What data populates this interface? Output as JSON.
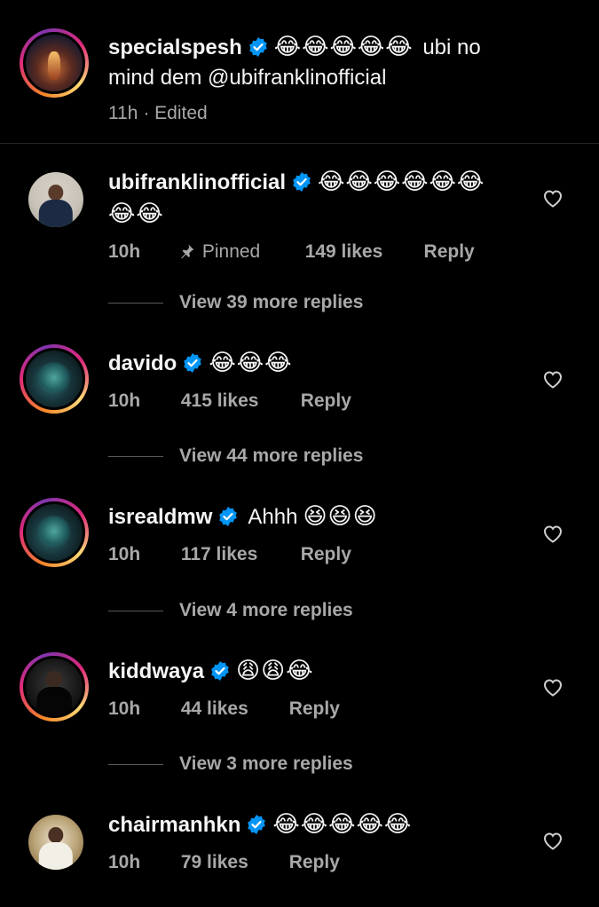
{
  "caption": {
    "username": "specialspesh",
    "emoji": "😂😂😂😂😂",
    "text_line1": "ubi no",
    "text_line2": "mind dem @ubifranklinofficial",
    "time": "11h",
    "separator": "·",
    "edited": "Edited",
    "avatar_icon": "avatar-image"
  },
  "comments": [
    {
      "username": "ubifranklinofficial",
      "emoji_line1": "😂😂😂😂😂😂",
      "emoji_line2": "😂😂",
      "time": "10h",
      "pinned": "Pinned",
      "likes": "149 likes",
      "reply": "Reply",
      "view_replies": "View 39 more replies"
    },
    {
      "username": "davido",
      "emoji_line1": "😂😂😂",
      "time": "10h",
      "likes": "415 likes",
      "reply": "Reply",
      "view_replies": "View 44 more replies"
    },
    {
      "username": "isrealdmw",
      "text": "Ahhh",
      "emoji_line1": "😆😆😆",
      "time": "10h",
      "likes": "117 likes",
      "reply": "Reply",
      "view_replies": "View 4 more replies"
    },
    {
      "username": "kiddwaya",
      "emoji_line1": "😩😩😂",
      "time": "10h",
      "likes": "44 likes",
      "reply": "Reply",
      "view_replies": "View 3 more replies"
    },
    {
      "username": "chairmanhkn",
      "emoji_line1": "😂😂😂😂😂",
      "time": "10h",
      "likes": "79 likes",
      "reply": "Reply"
    }
  ],
  "colors": {
    "background": "#000000",
    "text_primary": "#f5f5f5",
    "text_secondary": "#a8a8a8",
    "verified_blue": "#0095f6",
    "divider": "#262626"
  },
  "icons": {
    "verified": "verified-badge-icon",
    "heart": "heart-outline-icon",
    "pin": "pin-icon"
  }
}
